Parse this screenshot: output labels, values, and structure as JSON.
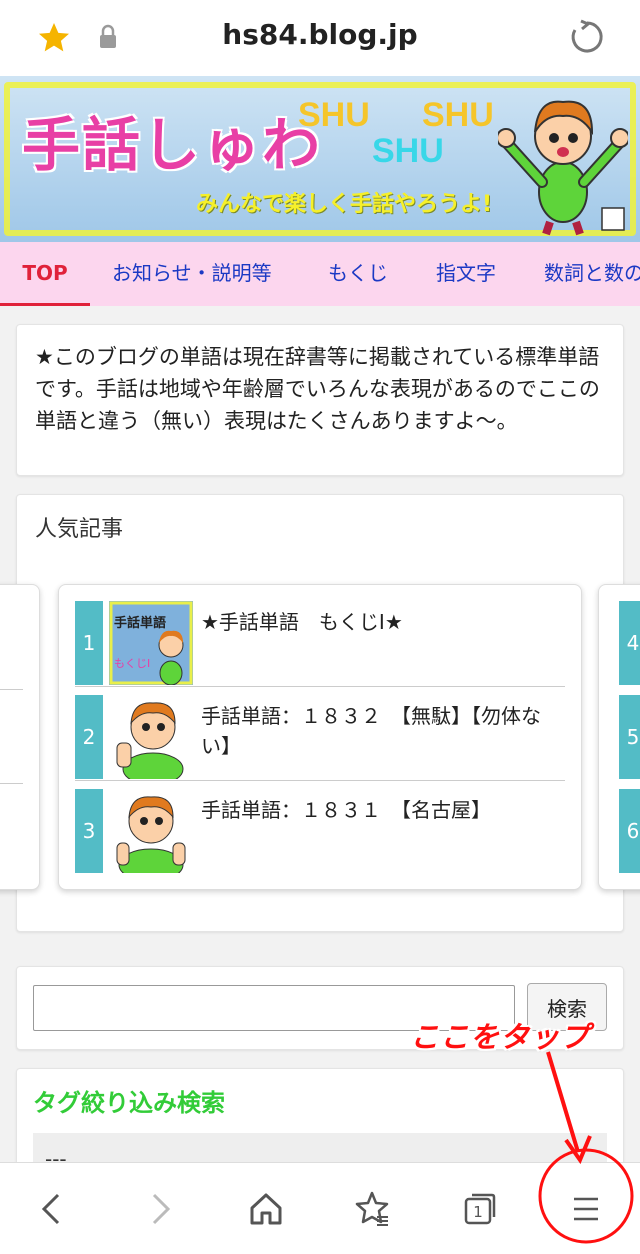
{
  "browser": {
    "url": "hs84.blog.jp",
    "icons": [
      "star-icon",
      "lock-icon",
      "reload-icon"
    ]
  },
  "banner": {
    "title": "手話しゅわ",
    "shu": [
      "SHU",
      "SHU",
      "SHU"
    ],
    "tagline": "みんなで楽しく手話やろうよ!"
  },
  "nav": {
    "tabs": [
      "TOP",
      "お知らせ・説明等",
      "もくじ",
      "指文字",
      "数詞と数の"
    ],
    "active": "TOP",
    "colors": {
      "active": "#e0223a",
      "link": "#1b39c4",
      "background": "#fcd6ee"
    }
  },
  "notice": {
    "text": "★このブログの単語は現在辞書等に掲載されている標準単語です。手話は地域や年齢層でいろんな表現があるのでここの単語と違う（無い）表現はたくさんありますよ～。"
  },
  "popular": {
    "heading": "人気記事",
    "items": [
      {
        "rank": "1",
        "title": "★手話単語　もくじⅠ★",
        "thumb_text": "手話単語",
        "thumb_sub": "もくじⅠ"
      },
      {
        "rank": "2",
        "title": "手話単語：１８３２　【無駄】【勿体ない】"
      },
      {
        "rank": "3",
        "title": "手話単語：１８３１　【名古屋】"
      }
    ],
    "right_peek": [
      "4",
      "5",
      "6"
    ],
    "rank_color": "#53bcc6"
  },
  "search": {
    "value": "",
    "button": "検索"
  },
  "tags": {
    "heading": "タグ絞り込み検索",
    "selected": "---"
  },
  "annotation": {
    "text": "ここをタップ",
    "color": "#ff1010"
  },
  "bottom_nav": {
    "icons": [
      "back-icon",
      "forward-icon",
      "home-icon",
      "bookmarks-icon",
      "tabs-icon",
      "menu-icon"
    ],
    "tabs_count": "1"
  }
}
